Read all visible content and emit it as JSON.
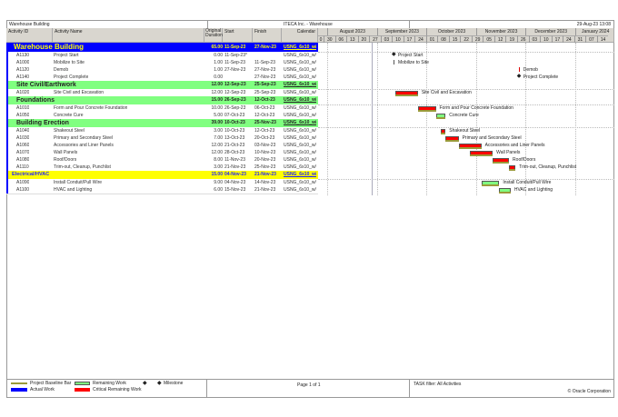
{
  "header": {
    "project": "Warehouse Building",
    "company": "ITECA Inc. - Warehouse",
    "timestamp": "29-Aug-23 13:08"
  },
  "columns": {
    "id": "Activity ID",
    "name": "Activity Name",
    "duration": "Original Duration",
    "start": "Start",
    "finish": "Finish",
    "calendar": "Calendar"
  },
  "timescale": {
    "months": [
      "August 2023",
      "September 2023",
      "October 2023",
      "November 2023",
      "December 2023",
      "January 2024"
    ],
    "weeks": [
      "30",
      "06",
      "13",
      "20",
      "27",
      "03",
      "10",
      "17",
      "24",
      "01",
      "08",
      "15",
      "22",
      "29",
      "05",
      "12",
      "19",
      "26",
      "03",
      "10",
      "17",
      "24",
      "31",
      "07",
      "14"
    ],
    "first_week_partial": "0"
  },
  "rows": [
    {
      "type": "wbs1",
      "id": "",
      "name": "Warehouse Building",
      "dur": "65.00",
      "start": "11-Sep-23",
      "finish": "27-Nov-23",
      "cal": "USNG_6x10_w/"
    },
    {
      "type": "act",
      "id": "A1130",
      "name": "Project Start",
      "dur": "0.00",
      "start": "11-Sep-23*",
      "finish": "",
      "cal": "USNG_6x10_w/",
      "bar": {
        "kind": "milestone",
        "s": "2023-09-11"
      }
    },
    {
      "type": "act",
      "id": "A1000",
      "name": "Mobilize to Site",
      "dur": "1.00",
      "start": "11-Sep-23",
      "finish": "11-Sep-23",
      "cal": "USNG_6x10_w/",
      "bar": {
        "kind": "thin",
        "s": "2023-09-11",
        "color": "#555"
      }
    },
    {
      "type": "act",
      "id": "A1120",
      "name": "Demob",
      "dur": "1.00",
      "start": "27-Nov-23",
      "finish": "27-Nov-23",
      "cal": "USNG_6x10_w/",
      "bar": {
        "kind": "thin",
        "s": "2023-11-27",
        "color": "#d00"
      }
    },
    {
      "type": "act",
      "id": "A1140",
      "name": "Project Complete",
      "dur": "0.00",
      "start": "",
      "finish": "27-Nov-23",
      "cal": "USNG_6x10_w/",
      "bar": {
        "kind": "milestone",
        "s": "2023-11-27"
      }
    },
    {
      "type": "wbs2",
      "id": "",
      "name": "Site Civil/Earthwork",
      "dur": "12.00",
      "start": "12-Sep-23",
      "finish": "25-Sep-23",
      "cal": "USNG_6x10_w/"
    },
    {
      "type": "act",
      "id": "A1020",
      "name": "Site Civil and Excavation",
      "dur": "12.00",
      "start": "12-Sep-23",
      "finish": "25-Sep-23",
      "cal": "USNG_6x10_w/",
      "bar": {
        "kind": "critical",
        "s": "2023-09-12",
        "e": "2023-09-26"
      }
    },
    {
      "type": "wbs2",
      "id": "",
      "name": "Foundations",
      "dur": "15.00",
      "start": "26-Sep-23",
      "finish": "12-Oct-23",
      "cal": "USNG_6x10_w/"
    },
    {
      "type": "act",
      "id": "A1010",
      "name": "Form and Pour Concrete Foundation",
      "dur": "10.00",
      "start": "26-Sep-23",
      "finish": "06-Oct-23",
      "cal": "USNG_6x10_w/",
      "bar": {
        "kind": "critical",
        "s": "2023-09-26",
        "e": "2023-10-07"
      }
    },
    {
      "type": "act",
      "id": "A1050",
      "name": "Concrete Cure",
      "dur": "5.00",
      "start": "07-Oct-23",
      "finish": "12-Oct-23",
      "cal": "USNG_6x10_w/",
      "bar": {
        "kind": "remaining",
        "s": "2023-10-07",
        "e": "2023-10-13"
      }
    },
    {
      "type": "wbs2",
      "id": "",
      "name": "Building Erection",
      "dur": "39.00",
      "start": "10-Oct-23",
      "finish": "25-Nov-23",
      "cal": "USNG_6x10_w/"
    },
    {
      "type": "act",
      "id": "A1040",
      "name": "Shakeout Steel",
      "dur": "3.00",
      "start": "10-Oct-23",
      "finish": "12-Oct-23",
      "cal": "USNG_6x10_w/",
      "bar": {
        "kind": "critical",
        "s": "2023-10-10",
        "e": "2023-10-13"
      }
    },
    {
      "type": "act",
      "id": "A1030",
      "name": "Primary and Secondary Steel",
      "dur": "7.00",
      "start": "13-Oct-23",
      "finish": "20-Oct-23",
      "cal": "USNG_6x10_w/",
      "bar": {
        "kind": "critical",
        "s": "2023-10-13",
        "e": "2023-10-21"
      }
    },
    {
      "type": "act",
      "id": "A1060",
      "name": "Accessories and Liner Panels",
      "dur": "12.00",
      "start": "21-Oct-23",
      "finish": "03-Nov-23",
      "cal": "USNG_6x10_w/",
      "bar": {
        "kind": "critical",
        "s": "2023-10-21",
        "e": "2023-11-04"
      }
    },
    {
      "type": "act",
      "id": "A1070",
      "name": "Wall Panels",
      "dur": "12.00",
      "start": "28-Oct-23",
      "finish": "10-Nov-23",
      "cal": "USNG_6x10_w/",
      "bar": {
        "kind": "critical",
        "s": "2023-10-28",
        "e": "2023-11-11"
      }
    },
    {
      "type": "act",
      "id": "A1080",
      "name": "Roof/Doors",
      "dur": "8.00",
      "start": "11-Nov-23",
      "finish": "20-Nov-23",
      "cal": "USNG_6x10_w/",
      "bar": {
        "kind": "critical",
        "s": "2023-11-11",
        "e": "2023-11-21"
      }
    },
    {
      "type": "act",
      "id": "A1110",
      "name": "Trim-out, Cleanup, Punchlist",
      "dur": "3.00",
      "start": "21-Nov-23",
      "finish": "25-Nov-23",
      "cal": "USNG_6x10_w/",
      "bar": {
        "kind": "critical",
        "s": "2023-11-21",
        "e": "2023-11-25"
      }
    },
    {
      "type": "wbs3",
      "id": "",
      "name": "Electrical/HVAC",
      "dur": "15.00",
      "start": "04-Nov-23",
      "finish": "21-Nov-23",
      "cal": "USNG_6x10_w/"
    },
    {
      "type": "act",
      "id": "A1090",
      "name": "Install Conduit/Pull Wire",
      "dur": "9.00",
      "start": "04-Nov-23",
      "finish": "14-Nov-23",
      "cal": "USNG_6x10_w/",
      "bar": {
        "kind": "remaining",
        "s": "2023-11-04",
        "e": "2023-11-15"
      }
    },
    {
      "type": "act",
      "id": "A1100",
      "name": "HVAC and Lighting",
      "dur": "6.00",
      "start": "15-Nov-23",
      "finish": "21-Nov-23",
      "cal": "USNG_6x10_w/",
      "bar": {
        "kind": "remaining",
        "s": "2023-11-15",
        "e": "2023-11-22"
      }
    }
  ],
  "legend": {
    "baseline": "Project Baseline Bar",
    "remaining": "Remaining Work",
    "milestone": "Milestone",
    "actual": "Actual Work",
    "critical": "Critical Remaining Work"
  },
  "footer": {
    "page": "Page 1 of 1",
    "filter": "TASK filter: All Activities",
    "copyright": "© Oracle Corporation"
  },
  "colors": {
    "wbs1": "#0000ff",
    "wbs2": "#80ff80",
    "wbs3": "#ffff00",
    "critical": "#ff0000",
    "remaining": "#80ff80",
    "actual": "#0000ff",
    "baseline": "#9a9a3a"
  }
}
